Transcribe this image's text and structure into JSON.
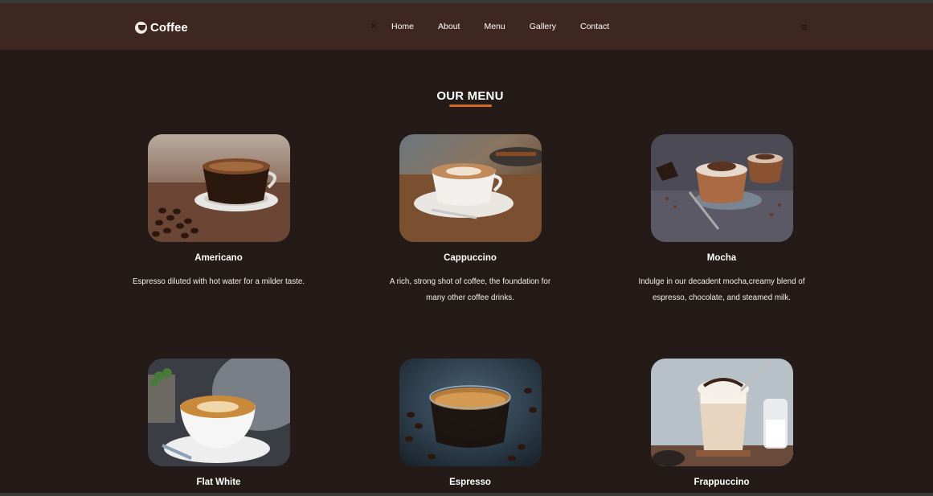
{
  "brand": {
    "logo_text": "Coffee",
    "logo_icon": "coffee-cup-icon"
  },
  "nav": {
    "close_glyph": "×",
    "links": [
      {
        "label": "Home"
      },
      {
        "label": "About"
      },
      {
        "label": "Menu"
      },
      {
        "label": "Gallery"
      },
      {
        "label": "Contact"
      }
    ],
    "menu_glyph": "≡"
  },
  "menu": {
    "title": "OUR MENU",
    "accent_color": "#d36a24",
    "items": [
      {
        "name": "Americano",
        "description": "Espresso diluted with hot water for a milder taste.",
        "image": "americano-photo"
      },
      {
        "name": "Cappuccino",
        "description": "A rich, strong shot of coffee, the foundation for many other coffee drinks.",
        "image": "cappuccino-photo"
      },
      {
        "name": "Mocha",
        "description": "Indulge in our decadent mocha,creamy blend of espresso, chocolate, and steamed milk.",
        "image": "mocha-photo"
      },
      {
        "name": "Flat White",
        "description": "",
        "image": "flat-white-photo"
      },
      {
        "name": "Espresso",
        "description": "",
        "image": "espresso-photo"
      },
      {
        "name": "Frappuccino",
        "description": "",
        "image": "frappuccino-photo"
      }
    ]
  }
}
